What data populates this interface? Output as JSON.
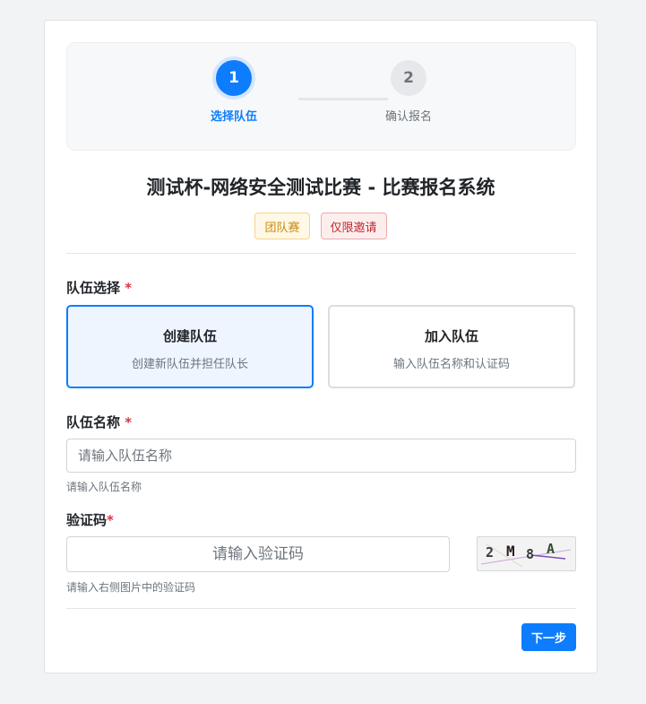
{
  "steps": [
    {
      "number": "1",
      "label": "选择队伍"
    },
    {
      "number": "2",
      "label": "确认报名"
    }
  ],
  "title": "测试杯-网络安全测试比赛 - 比赛报名系统",
  "badges": {
    "team": "团队赛",
    "invite": "仅限邀请"
  },
  "team_choice": {
    "label": "队伍选择",
    "required_mark": "*",
    "options": [
      {
        "title": "创建队伍",
        "desc": "创建新队伍并担任队长",
        "selected": true
      },
      {
        "title": "加入队伍",
        "desc": "输入队伍名称和认证码",
        "selected": false
      }
    ]
  },
  "team_name": {
    "label": "队伍名称",
    "required_mark": "*",
    "value": "",
    "placeholder": "请输入队伍名称",
    "help": "请输入队伍名称"
  },
  "captcha": {
    "label": "验证码",
    "required_mark": "*",
    "value": "",
    "placeholder": "请输入验证码",
    "help": "请输入右侧图片中的验证码",
    "image_text": "2M8A"
  },
  "next_button": "下一步",
  "colors": {
    "accent": "#0d7dfd",
    "required": "#dc3545",
    "background": "#f2f3f5"
  }
}
